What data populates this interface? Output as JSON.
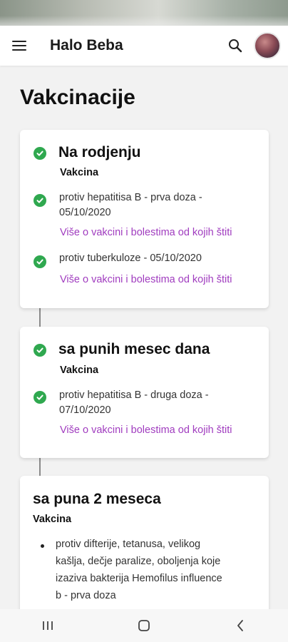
{
  "app": {
    "title": "Halo Beba"
  },
  "page": {
    "title": "Vakcinacije"
  },
  "icons": {
    "menu": "hamburger-menu-icon",
    "search": "search-icon",
    "avatar": "user-avatar",
    "done": "check-circle-icon"
  },
  "colors": {
    "check": "#2fa84f",
    "link": "#a03cbf"
  },
  "cards": [
    {
      "title": "Na rodjenju",
      "label": "Vakcina",
      "completed": true,
      "items": [
        {
          "name_line1": "protiv hepatitisa B - prva doza -",
          "name_line2": "05/10/2020",
          "link": "Više o vakcini i bolestima od kojih štiti",
          "completed": true
        },
        {
          "name_line1": "protiv tuberkuloze  - 05/10/2020",
          "link": "Više o vakcini i bolestima od kojih štiti",
          "completed": true
        }
      ]
    },
    {
      "title": "sa punih mesec dana",
      "label": "Vakcina",
      "completed": true,
      "items": [
        {
          "name_line1": "protiv hepatitisa B - druga doza -",
          "name_line2": "07/10/2020",
          "link": "Više o vakcini i bolestima od kojih štiti",
          "completed": true
        }
      ]
    },
    {
      "title": "sa puna 2 meseca",
      "label": "Vakcina",
      "completed": false,
      "items": [
        {
          "lines": [
            "protiv difterije, tetanusa, velikog",
            "kašlja, dečje paralize, oboljenja koje",
            "izaziva bakterija Hemofilus influence",
            "b - prva doza"
          ],
          "completed": false
        }
      ]
    }
  ],
  "navbar": {
    "recent": "recent-apps-icon",
    "home": "home-icon",
    "back": "back-icon"
  }
}
